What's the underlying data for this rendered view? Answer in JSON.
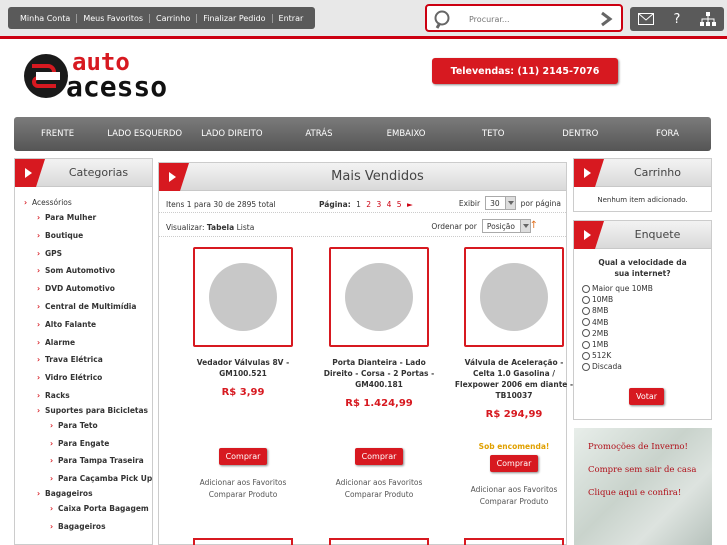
{
  "top_links": [
    "Minha Conta",
    "Meus Favoritos",
    "Carrinho",
    "Finalizar Pedido",
    "Entrar"
  ],
  "search": {
    "placeholder": "Procurar..."
  },
  "util_icons": [
    "mail-icon",
    "help-icon",
    "sitemap-icon"
  ],
  "logo": {
    "line1": "auto",
    "line2": "acesso"
  },
  "phone": "Televendas: (11) 2145-7076",
  "nav": [
    "FRENTE",
    "LADO ESQUERDO",
    "LADO DIREITO",
    "ATRÁS",
    "EMBAIXO",
    "TETO",
    "DENTRO",
    "FORA"
  ],
  "categories": {
    "title": "Categorias",
    "items": [
      {
        "label": "Acessórios",
        "level": 0
      },
      {
        "label": "Para Mulher",
        "level": 1
      },
      {
        "label": "Boutique",
        "level": 1
      },
      {
        "label": "GPS",
        "level": 1
      },
      {
        "label": "Som Automotivo",
        "level": 1
      },
      {
        "label": "DVD Automotivo",
        "level": 1
      },
      {
        "label": "Central de Multimídia",
        "level": 1
      },
      {
        "label": "Alto Falante",
        "level": 1
      },
      {
        "label": "Alarme",
        "level": 1
      },
      {
        "label": "Trava Elétrica",
        "level": 1
      },
      {
        "label": "Vidro Elétrico",
        "level": 1
      },
      {
        "label": "Racks",
        "level": 1
      },
      {
        "label": "Suportes para Bicicletas",
        "level": 1,
        "small": true
      },
      {
        "label": "Para Teto",
        "level": 2
      },
      {
        "label": "Para Engate",
        "level": 2
      },
      {
        "label": "Para Tampa Traseira",
        "level": 2
      },
      {
        "label": "Para Caçamba Pick Up",
        "level": 2
      },
      {
        "label": "Bagageiros",
        "level": 1,
        "small": true
      },
      {
        "label": "Caixa Porta Bagagem",
        "level": 2
      },
      {
        "label": "Bagageiros",
        "level": 2
      }
    ]
  },
  "main": {
    "title": "Mais Vendidos",
    "items_text": "Itens 1 para 30 de 2895 total",
    "page_label": "Página:",
    "pages": [
      "1",
      "2",
      "3",
      "4",
      "5"
    ],
    "current_page": "1",
    "next_symbol": "►",
    "show_label": "Exibir",
    "show_value": "30",
    "per_page": "por página",
    "view_label": "Visualizar:",
    "view_table": "Tabela",
    "view_list": "Lista",
    "sort_label": "Ordenar por",
    "sort_value": "Posição",
    "sort_dir_symbol": "↑",
    "products": [
      {
        "name": "Vedador Válvulas 8V - GM100.521",
        "price": "R$ 3,99",
        "status": ""
      },
      {
        "name": "Porta Dianteira - Lado Direito - Corsa - 2 Portas - GM400.181",
        "price": "R$ 1.424,99",
        "status": ""
      },
      {
        "name": "Válvula de Aceleração - Celta 1.0 Gasolina / Flexpower 2006 em diante - TB10037",
        "price": "R$ 294,99",
        "status": "Sob encomenda!"
      }
    ],
    "buy_label": "Comprar",
    "fav_label": "Adicionar aos Favoritos",
    "compare_label": "Comparar Produto"
  },
  "cart": {
    "title": "Carrinho",
    "message": "Nenhum item adicionado."
  },
  "poll": {
    "title": "Enquete",
    "question": "Qual a velocidade da sua internet?",
    "options": [
      "Maior que 10MB",
      "10MB",
      "8MB",
      "4MB",
      "2MB",
      "1MB",
      "512K",
      "Discada"
    ],
    "vote_label": "Votar"
  },
  "promo": {
    "line1": "Promoções de Inverno!",
    "line2": "Compre sem sair de casa",
    "line3": "Clique aqui e confira!"
  },
  "colors": {
    "accent": "#d71920",
    "bar": "#5a5a5a"
  }
}
